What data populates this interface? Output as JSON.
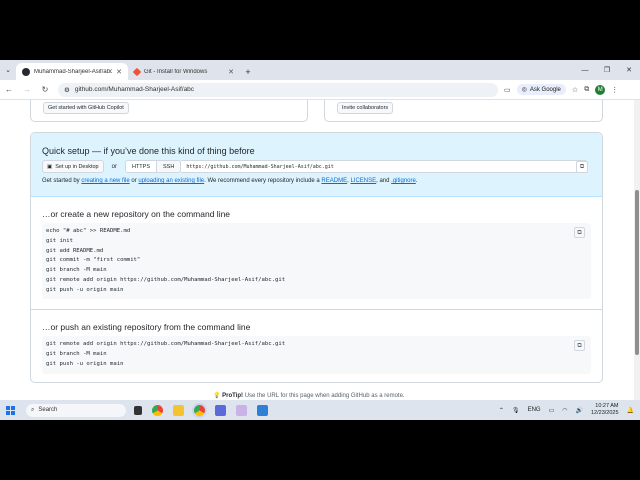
{
  "browser": {
    "tabs": [
      {
        "title": "Muhammad-Sharjeel-Asif/abc",
        "active": true
      },
      {
        "title": "Git - Install for Windows",
        "active": false
      }
    ],
    "url": "github.com/Muhammad-Sharjeel-Asif/abc",
    "ask_google": "Ask Google",
    "profile_initial": "M"
  },
  "top_cards": {
    "copilot_button": "Get started with GitHub Copilot",
    "invite_button": "Invite collaborators"
  },
  "quick_setup": {
    "title": "Quick setup — if you’ve done this kind of thing before",
    "desktop_button": "Set up in Desktop",
    "or_text": "or",
    "https_label": "HTTPS",
    "ssh_label": "SSH",
    "clone_url": "https://github.com/Muhammad-Sharjeel-Asif/abc.git",
    "hint_prefix": "Get started by",
    "hint_new_file": "creating a new file",
    "hint_or": "or",
    "hint_upload": "uploading an existing file",
    "hint_middle": ". We recommend every repository include a",
    "hint_readme": "README",
    "hint_comma": ",",
    "hint_license": "LICENSE",
    "hint_and": ", and",
    "hint_gitignore": ".gitignore",
    "hint_end": "."
  },
  "create_section": {
    "title": "…or create a new repository on the command line",
    "code": [
      "echo \"# abc\" >> README.md",
      "git init",
      "git add README.md",
      "git commit -m \"first commit\"",
      "git branch -M main",
      "git remote add origin https://github.com/Muhammad-Sharjeel-Asif/abc.git",
      "git push -u origin main"
    ]
  },
  "push_section": {
    "title": "…or push an existing repository from the command line",
    "code": [
      "git remote add origin https://github.com/Muhammad-Sharjeel-Asif/abc.git",
      "git branch -M main",
      "git push -u origin main"
    ]
  },
  "protip": {
    "label": "ProTip!",
    "text": "Use the URL for this page when adding GitHub as a remote."
  },
  "taskbar": {
    "search_placeholder": "Search",
    "language": "ENG",
    "time": "10:27 AM",
    "date": "12/23/2025"
  }
}
